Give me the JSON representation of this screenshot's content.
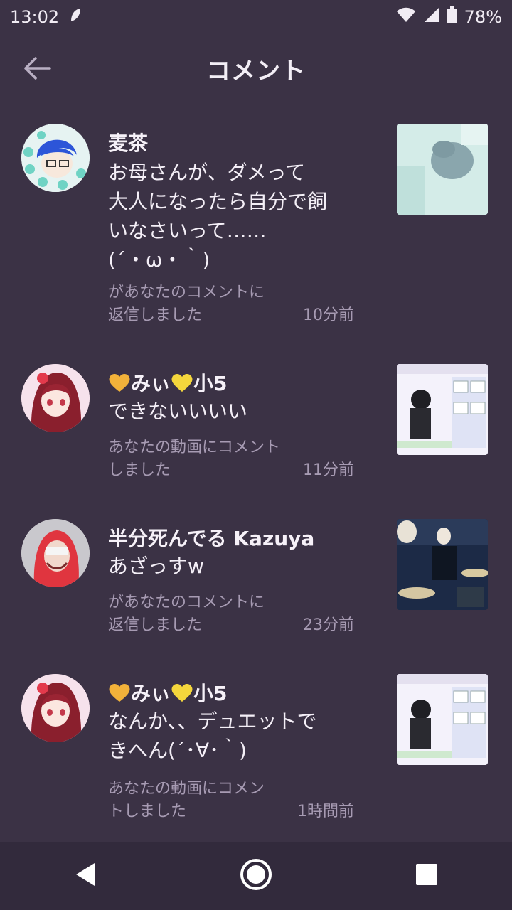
{
  "status_bar": {
    "time": "13:02",
    "battery": "78%",
    "icons": [
      "notification-leaf-icon",
      "wifi-icon",
      "signal-icon",
      "battery-icon"
    ]
  },
  "header": {
    "title": "コメント",
    "back_icon": "arrow-left-icon"
  },
  "comments": [
    {
      "user": "麦茶",
      "text": "お母さんが、ダメって\n大人になったら自分で飼\nいなさいって……\n(´・ω・｀)",
      "desc": "があなたのコメントに\n返信しました",
      "time": "10分前"
    },
    {
      "user_suffix": "小5",
      "user_middle": "みぃ",
      "text": "できないいいい",
      "desc": "あなたの動画にコメント\nしました",
      "time": "11分前"
    },
    {
      "user": "半分死んでる Kazuya",
      "text": "あざっすw",
      "desc": "があなたのコメントに\n返信しました",
      "time": "23分前"
    },
    {
      "user_suffix": "小5",
      "user_middle": "みぃ",
      "text": "なんか、、デュエットで\nきへん(´･∀･｀)",
      "desc": "あなたの動画にコメン\nトしました",
      "time": "1時間前"
    }
  ],
  "colors": {
    "background": "#3b3245",
    "heart_orange": "#f2b23a",
    "heart_yellow": "#f4d63c",
    "meta_text": "#a79bb3"
  },
  "nav_bar": {
    "icons": [
      "back-triangle-icon",
      "home-circle-icon",
      "recents-square-icon"
    ]
  }
}
